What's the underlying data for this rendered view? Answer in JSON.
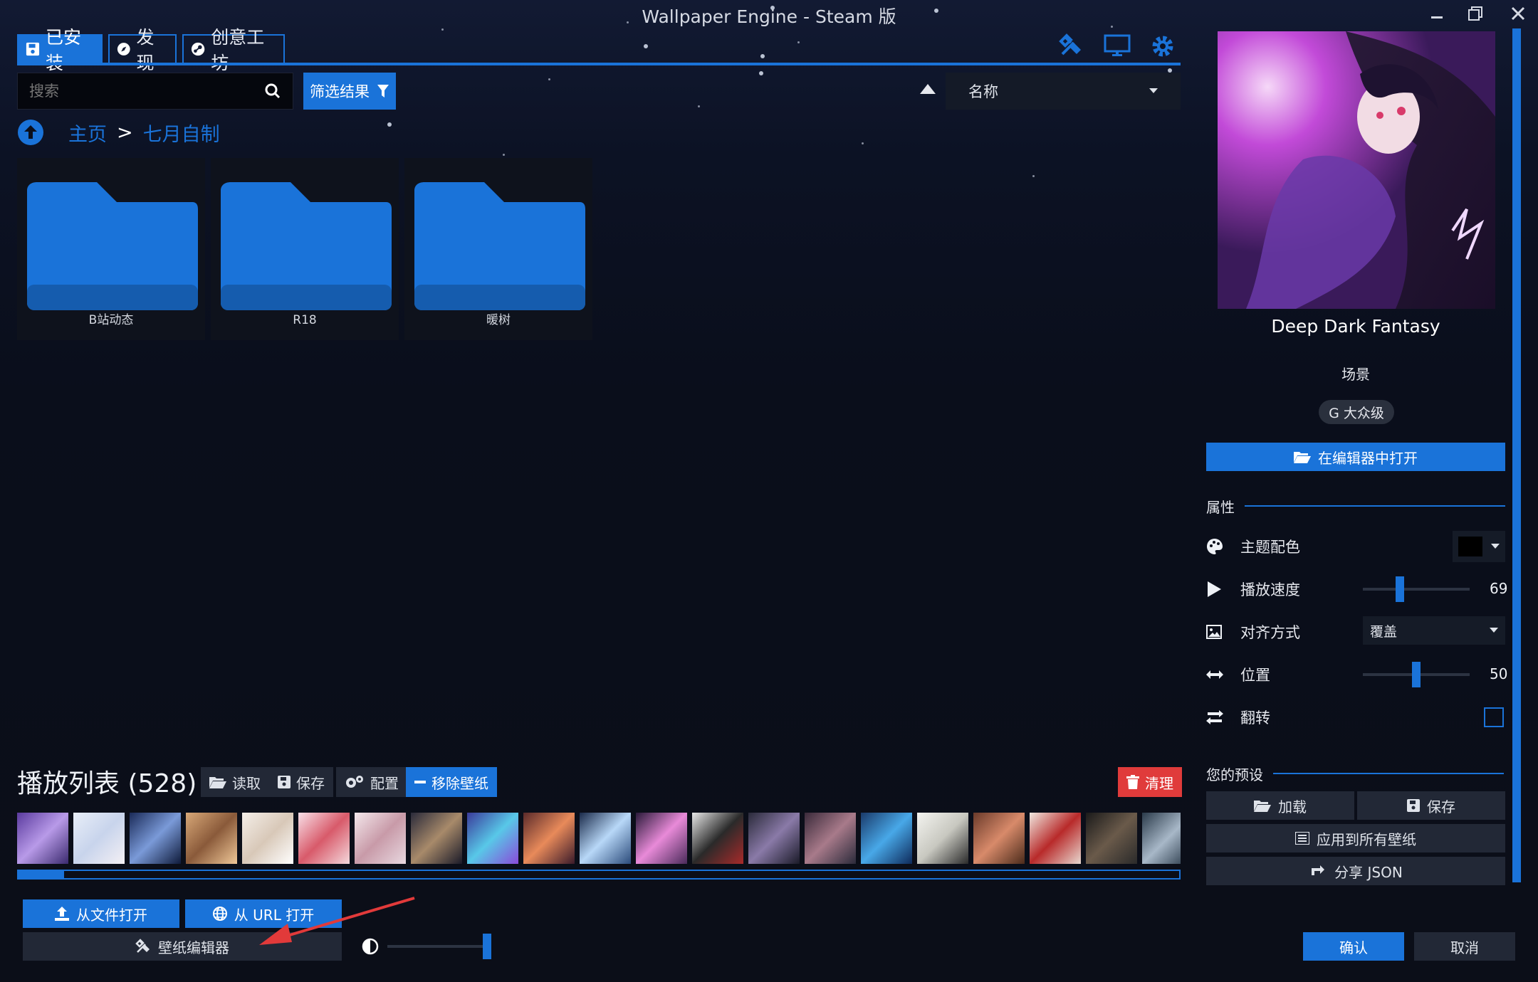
{
  "window": {
    "title": "Wallpaper Engine - Steam 版"
  },
  "tabs": [
    {
      "label": "已安装",
      "icon": "save-icon"
    },
    {
      "label": "发现",
      "icon": "compass-icon"
    },
    {
      "label": "创意工坊",
      "icon": "steam-icon"
    }
  ],
  "toolbar_icons": [
    "editor-tools-icon",
    "monitor-icon",
    "gear-icon"
  ],
  "search": {
    "placeholder": "搜索",
    "value": ""
  },
  "filter": {
    "label": "筛选结果"
  },
  "sort": {
    "selected": "名称"
  },
  "breadcrumb": {
    "home": "主页",
    "separator": ">",
    "current": "七月自制"
  },
  "folders": [
    {
      "name": "B站动态"
    },
    {
      "name": "R18"
    },
    {
      "name": "暖树"
    }
  ],
  "playlist": {
    "title": "播放列表 (528)",
    "buttons": {
      "load": "读取",
      "save": "保存",
      "config": "配置",
      "remove": "移除壁纸",
      "clear": "清理"
    },
    "thumbnail_count": 21
  },
  "bottom": {
    "open_file": "从文件打开",
    "open_url": "从 URL 打开",
    "wallpaper_editor": "壁纸编辑器",
    "brightness_level": 1.0
  },
  "details": {
    "title": "Deep Dark Fantasy",
    "type": "场景",
    "rating": "G 大众级",
    "open_in_editor": "在编辑器中打开"
  },
  "properties": {
    "header": "属性",
    "theme_color": {
      "label": "主题配色",
      "value": "#000000"
    },
    "playback_speed": {
      "label": "播放速度",
      "value": "69",
      "fraction": 0.33
    },
    "alignment": {
      "label": "对齐方式",
      "value": "覆盖"
    },
    "position": {
      "label": "位置",
      "value": "50",
      "fraction": 0.5
    },
    "flip": {
      "label": "翻转",
      "checked": false
    }
  },
  "presets": {
    "header": "您的预设",
    "load": "加载",
    "save": "保存",
    "apply_all": "应用到所有壁纸",
    "share_json": "分享 JSON"
  },
  "dialog": {
    "confirm": "确认",
    "cancel": "取消"
  },
  "colors": {
    "accent": "#1a73d9",
    "danger": "#e03b3b",
    "background": "#0b0f1c"
  }
}
